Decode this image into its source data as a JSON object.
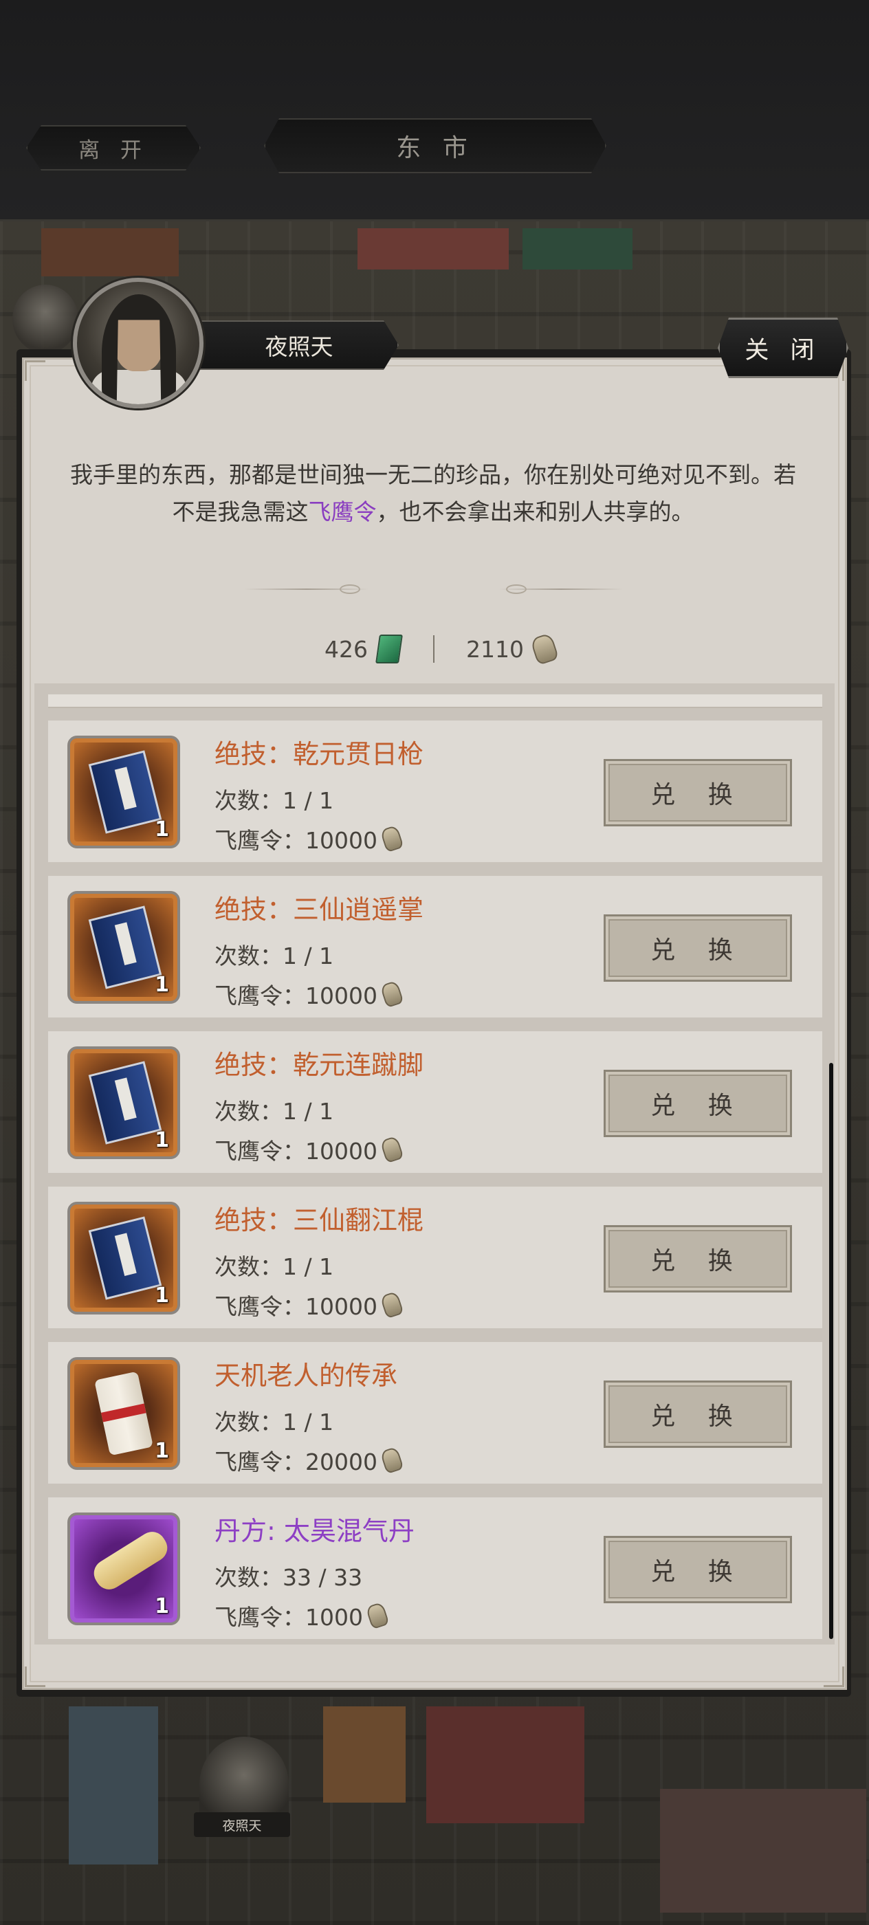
{
  "topbar": {
    "leave_label": "离 开",
    "location_title": "东 市"
  },
  "npc": {
    "name": "夜照天",
    "close_label": "关 闭",
    "dialog_before": "我手里的东西，那都是世间独一无二的珍品，你在别处可绝对见不到。若不是我急需这",
    "dialog_highlight": "飞鹰令",
    "dialog_after": "，也不会拿出来和别人共享的。",
    "highlight_color": "#8a3ec0"
  },
  "currency": {
    "jade_amount": "426",
    "jade_icon": "jade-tablet-icon",
    "token_amount": "2110",
    "token_icon": "feiying-token-icon"
  },
  "items": [
    {
      "name": "绝技：乾元贯日枪",
      "count": "次数：1 / 1",
      "price": "飞鹰令：10000",
      "qty": "1",
      "rarity": "orange",
      "icon": "manual-book-icon",
      "button": "兑 换"
    },
    {
      "name": "绝技：三仙逍遥掌",
      "count": "次数：1 / 1",
      "price": "飞鹰令：10000",
      "qty": "1",
      "rarity": "orange",
      "icon": "manual-book-icon",
      "button": "兑 换"
    },
    {
      "name": "绝技：乾元连蹴脚",
      "count": "次数：1 / 1",
      "price": "飞鹰令：10000",
      "qty": "1",
      "rarity": "orange",
      "icon": "manual-book-icon",
      "button": "兑 换"
    },
    {
      "name": "绝技：三仙翻江棍",
      "count": "次数：1 / 1",
      "price": "飞鹰令：10000",
      "qty": "1",
      "rarity": "orange",
      "icon": "manual-book-icon",
      "button": "兑 换"
    },
    {
      "name": "天机老人的传承",
      "count": "次数：1 / 1",
      "price": "飞鹰令：20000",
      "qty": "1",
      "rarity": "orange",
      "icon": "inheritance-scroll-icon",
      "button": "兑 换"
    },
    {
      "name": "丹方: 太昊混气丹",
      "count": "次数：33 / 33",
      "price": "飞鹰令：1000",
      "qty": "1",
      "rarity": "purple",
      "icon": "recipe-scroll-icon",
      "button": "兑 换"
    }
  ],
  "map_npc_label": "夜照天",
  "colors": {
    "orange_item_name": "#c15f2e",
    "purple_item_name": "#8d3fc4",
    "panel_bg": "#d8d3cc"
  }
}
